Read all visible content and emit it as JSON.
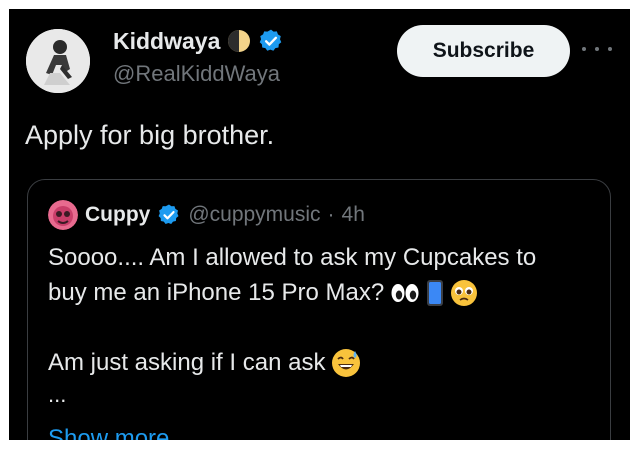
{
  "author": {
    "display_name": "Kiddwaya",
    "handle": "@RealKiddWaya",
    "avatar_icon": "avatar-photo",
    "badges": [
      "half-moon-icon",
      "verified-icon"
    ]
  },
  "subscribe_label": "Subscribe",
  "more_icon": "more-options-icon",
  "tweet_text": "Apply for big brother.",
  "quoted": {
    "display_name": "Cuppy",
    "handle": "@cuppymusic",
    "separator": "·",
    "time": "4h",
    "line1": "Soooo.... Am I allowed to ask my Cupcakes to",
    "line2": "buy me an iPhone 15 Pro Max?",
    "line3": "Am just asking if I can ask",
    "ellipsis": "...",
    "emojis": [
      "eyes-emoji",
      "phone-emoji",
      "pleading-face-emoji",
      "grinning-sweat-emoji"
    ],
    "show_more_label": "Show more"
  },
  "colors": {
    "background": "#000000",
    "text": "#e7e9ea",
    "muted": "#71767b",
    "link": "#1d9bf0",
    "verified": "#1d9bf0",
    "button_bg": "#eff3f4"
  }
}
